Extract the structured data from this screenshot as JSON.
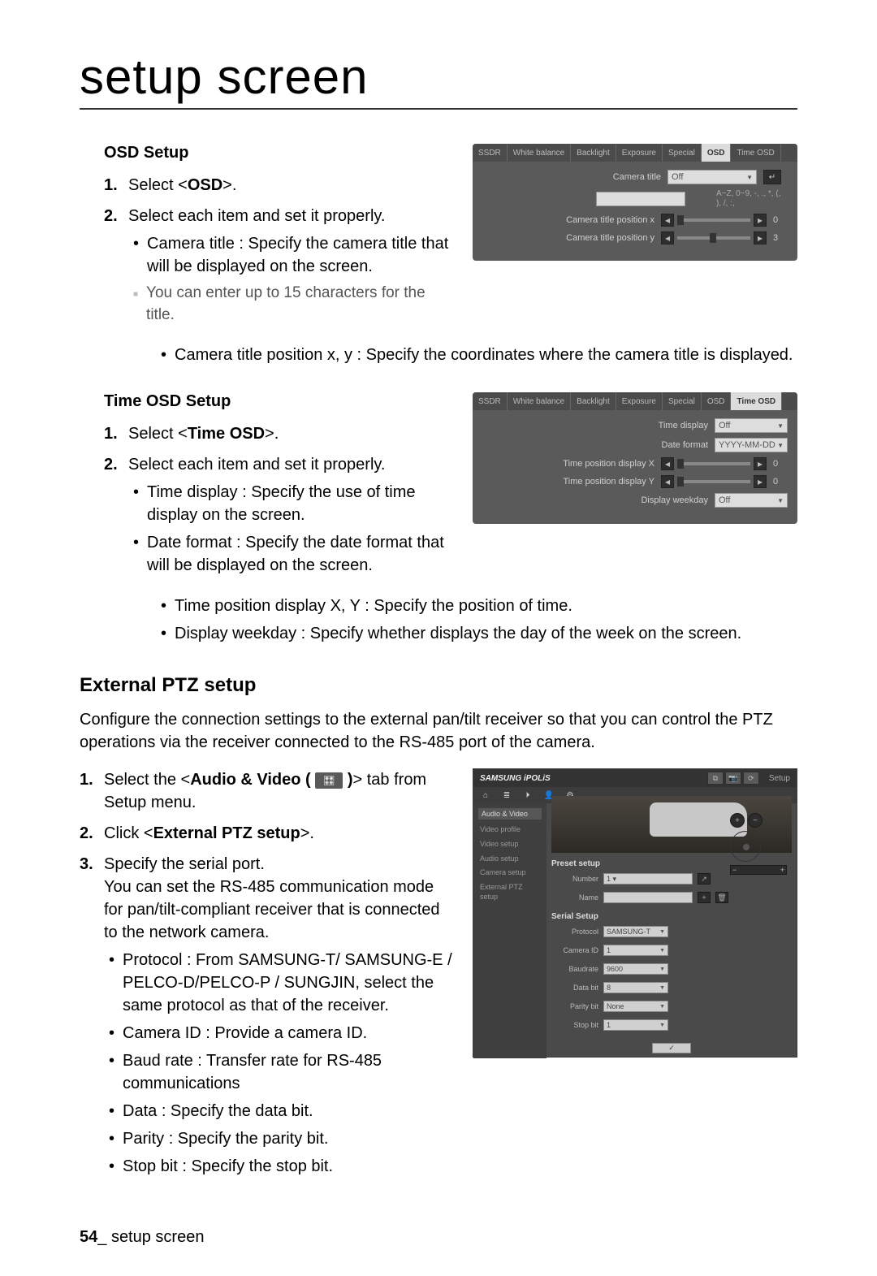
{
  "page": {
    "title": "setup screen",
    "number": "54",
    "footer_label": "setup screen"
  },
  "osd_section": {
    "heading": "OSD Setup",
    "step1_prefix": "Select <",
    "step1_bold": "OSD",
    "step1_suffix": ">.",
    "step2": "Select each item and set it properly.",
    "bullet_title_a": "Camera title : Specify the camera title that will be displayed on the screen.",
    "note_chars": "You can enter up to 15 characters for the title.",
    "bullet_pos": "Camera title position x, y : Specify the coordinates where the camera title is displayed."
  },
  "osd_panel": {
    "tabs": [
      "SSDR",
      "White balance",
      "Backlight",
      "Exposure",
      "Special",
      "OSD",
      "Time OSD"
    ],
    "active_tab_index": 5,
    "rows": {
      "camera_title_label": "Camera title",
      "camera_title_value": "Off",
      "clear_btn": "↵",
      "char_hint": "A~Z, 0~9, -, ., *,\n(, ), /, :,",
      "pos_x_label": "Camera title position x",
      "pos_x_val": "0",
      "pos_y_label": "Camera title position y",
      "pos_y_val": "3"
    }
  },
  "timeosd_section": {
    "heading": "Time OSD Setup",
    "step1_prefix": "Select <",
    "step1_bold": "Time OSD",
    "step1_suffix": ">.",
    "step2": "Select each item and set it properly.",
    "bullet_time_display": "Time display : Specify the use of time display on the screen.",
    "bullet_date_format": "Date format : Specify the date format that will be displayed on the screen.",
    "bullet_time_pos": "Time position display X, Y : Specify the position of time.",
    "bullet_weekday": "Display weekday : Specify whether displays the day of the week on the screen."
  },
  "timeosd_panel": {
    "tabs": [
      "SSDR",
      "White balance",
      "Backlight",
      "Exposure",
      "Special",
      "OSD",
      "Time OSD"
    ],
    "active_tab_index": 6,
    "rows": {
      "time_display_label": "Time display",
      "time_display_value": "Off",
      "date_format_label": "Date format",
      "date_format_value": "YYYY-MM-DD",
      "pos_x_label": "Time position display X",
      "pos_x_val": "0",
      "pos_y_label": "Time position display Y",
      "pos_y_val": "0",
      "weekday_label": "Display weekday",
      "weekday_value": "Off"
    }
  },
  "ptz_section": {
    "heading": "External PTZ setup",
    "intro": "Configure the connection settings to the external pan/tilt receiver so that you can control the PTZ operations via the receiver connected to the RS-485 port of the camera.",
    "step1_a": "Select the <",
    "step1_bold": "Audio & Video (",
    "step1_icon": "🎛",
    "step1_b": ")",
    "step1_c": "> tab from Setup menu.",
    "step2_a": "Click <",
    "step2_bold": "External PTZ setup",
    "step2_b": ">.",
    "step3_head": "Specify the serial port.",
    "step3_body": "You can set the RS-485 communication mode for pan/tilt-compliant receiver that is connected to the network camera.",
    "bullet_protocol": "Protocol : From SAMSUNG-T/ SAMSUNG-E / PELCO-D/PELCO-P / SUNGJIN, select the same protocol as that of the receiver.",
    "bullet_camera_id": "Camera ID : Provide a camera ID.",
    "bullet_baud": "Baud rate : Transfer rate for RS-485 communications",
    "bullet_data": "Data : Specify the data bit.",
    "bullet_parity": "Parity : Specify the parity bit.",
    "bullet_stop": "Stop bit : Specify the stop bit."
  },
  "ptz_shot": {
    "logo_a": "SAMSUNG ",
    "logo_b": "iPOLiS",
    "crumb": "Setup",
    "top_icons": [
      "⧉",
      "📷",
      "⟳"
    ],
    "nav_icons": [
      "⌂",
      "≣",
      "⏵",
      "👤",
      "⚙"
    ],
    "side_heading": "Audio & Video",
    "side_items": [
      "Video profile",
      "Video setup",
      "Audio setup",
      "Camera setup",
      "External PTZ setup"
    ],
    "preview_right": {
      "plus": "+",
      "minus": "−",
      "zoom_out": "−",
      "zoom_in": "+"
    },
    "preset_heading": "Preset setup",
    "preset_number_label": "Number",
    "preset_number_value": "1 ▾",
    "preset_go": "↗",
    "preset_name_label": "Name",
    "preset_add": "+",
    "preset_del": "🗑",
    "serial_heading": "Serial Setup",
    "fields": {
      "protocol_label": "Protocol",
      "protocol_value": "SAMSUNG-T",
      "camera_id_label": "Camera ID",
      "camera_id_value": "1",
      "baud_label": "Baudrate",
      "baud_value": "9600",
      "data_label": "Data bit",
      "data_value": "8",
      "parity_label": "Parity bit",
      "parity_value": "None",
      "stop_label": "Stop bit",
      "stop_value": "1"
    },
    "apply": "✓"
  }
}
